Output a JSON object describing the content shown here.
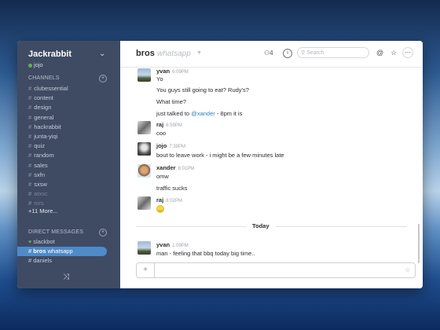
{
  "sidebar": {
    "team_name": "Jackrabbit",
    "team_chevron": "⌄",
    "current_user": "jojo",
    "channels_header": "CHANNELS",
    "channels": [
      "clubessential",
      "content",
      "design",
      "general",
      "hackrabbit",
      "junta-yiqi",
      "quiz",
      "random",
      "sales",
      "sxfn",
      "sxsw",
      "atxsc",
      "mrs"
    ],
    "more_link": "+11 More...",
    "dm_header": "DIRECT MESSAGES",
    "dms": [
      {
        "icon": "heart-icon",
        "glyph": "♥",
        "name": "slackbot",
        "extra": ""
      },
      {
        "icon": "hash-icon",
        "glyph": "#",
        "name": "bros",
        "extra": " whatsapp"
      },
      {
        "icon": "hash-icon",
        "glyph": "#",
        "name": "daniels",
        "extra": ""
      }
    ],
    "shuffle_glyph": "⤨"
  },
  "header": {
    "channel_name": "bros",
    "channel_purpose": "whatsapp",
    "member_count": "4",
    "search_placeholder": "Search",
    "icons": [
      "members-icon",
      "info-icon",
      "search-icon",
      "at-icon",
      "star-icon",
      "more-icon"
    ]
  },
  "messages": [
    {
      "author": "yvan",
      "time": "6:09PM",
      "lines": [
        "Yo",
        "You guys still going to eat? Rudy's?",
        "What time?"
      ],
      "mention_line": {
        "prefix": "just talked to ",
        "mention": "@xander",
        "suffix": " - 8pm it is"
      }
    },
    {
      "author": "raj",
      "time": "6:59PM",
      "lines": [
        "coo"
      ]
    },
    {
      "author": "jojo",
      "time": "7:39PM",
      "lines": [
        "bout to leave work - i might be a few minutes late"
      ]
    },
    {
      "author": "xander",
      "time": "8:01PM",
      "lines": [
        "omw",
        "traffic sucks"
      ]
    },
    {
      "author": "raj",
      "time": "8:02PM",
      "lines": [],
      "emoji": "smile-emoji"
    },
    {
      "author": "yvan",
      "time": "1:09PM",
      "lines": [
        "man - feeling that bbq today big time.."
      ]
    }
  ],
  "divider_label": "Today",
  "composer": {
    "plus_glyph": "+",
    "placeholder": "",
    "emoji_glyph": "☺"
  },
  "colors": {
    "sidebar": "#3f4b63",
    "active_item": "#4f8ac9",
    "presence": "#5ab557",
    "mention": "#2a80b9"
  }
}
